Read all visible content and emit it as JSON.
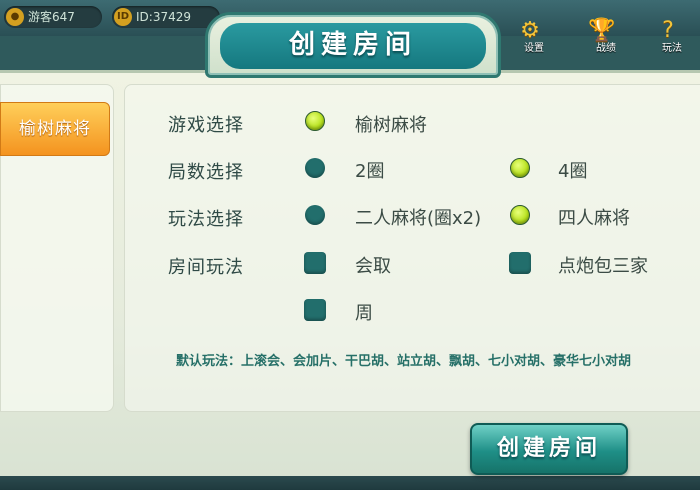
{
  "topbar": {
    "guest_label": "游客647",
    "id_label": "ID:37429",
    "settings_label": "设置",
    "rank_label": "战绩",
    "help_label": "玩法"
  },
  "dialog": {
    "title": "创建房间"
  },
  "sidebar": {
    "game_tab": "榆树麻将"
  },
  "options": {
    "game": {
      "label": "游戏选择",
      "choices": [
        "榆树麻将"
      ],
      "selected": "榆树麻将"
    },
    "rounds": {
      "label": "局数选择",
      "choices": [
        "2圈",
        "4圈"
      ],
      "selected": "4圈"
    },
    "mode": {
      "label": "玩法选择",
      "choices": [
        "二人麻将(圈x2)",
        "四人麻将"
      ],
      "selected": "四人麻将"
    },
    "room_rules": {
      "label": "房间玩法",
      "choices": [
        "会取",
        "点炮包三家",
        "周"
      ],
      "checked": []
    }
  },
  "default_rules": "默认玩法：上滚会、会加片、干巴胡、站立胡、飘胡、七小对胡、豪华七小对胡",
  "create_button": "创建房间",
  "colors": {
    "accent": "#1f8f87",
    "selected_radio": "#b7e21c",
    "tab_orange": "#f4931f"
  }
}
